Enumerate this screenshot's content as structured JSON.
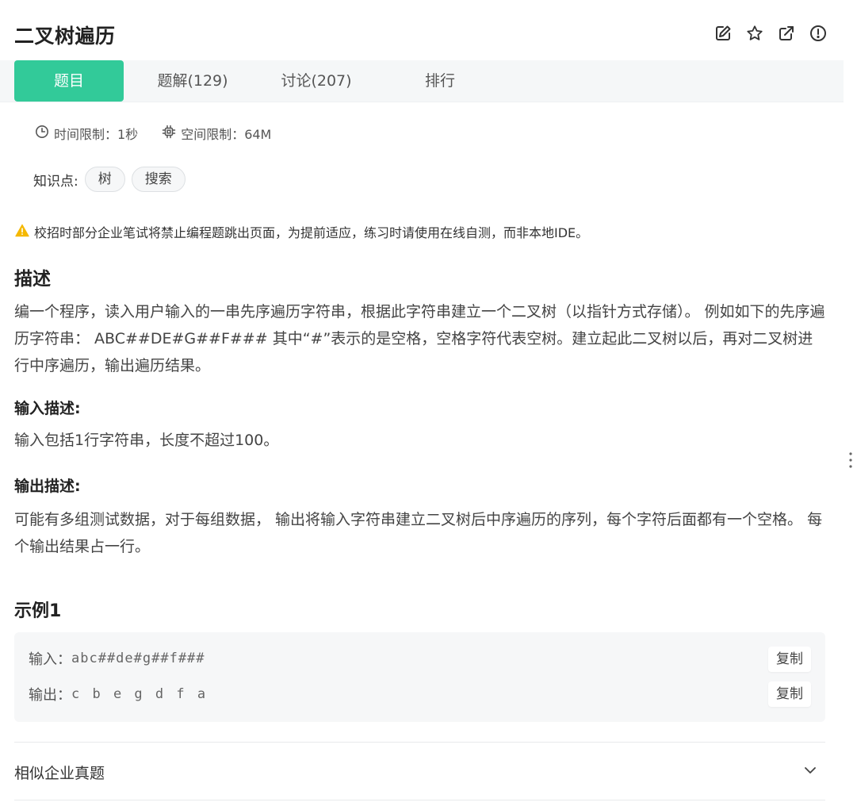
{
  "title": "二叉树遍历",
  "header_icons": [
    "edit-icon",
    "star-icon",
    "open-external-icon",
    "report-icon"
  ],
  "tabs": [
    {
      "label": "题目",
      "active": true
    },
    {
      "label": "题解(129)",
      "active": false
    },
    {
      "label": "讨论(207)",
      "active": false
    },
    {
      "label": "排行",
      "active": false
    }
  ],
  "limits": {
    "time": "时间限制：1秒",
    "space": "空间限制：64M"
  },
  "knowledge": {
    "label": "知识点:",
    "tags": [
      "树",
      "搜索"
    ]
  },
  "warning": "校招时部分企业笔试将禁止编程题跳出页面，为提前适应，练习时请使用在线自测，而非本地IDE。",
  "description": {
    "heading": "描述",
    "text": "编一个程序，读入用户输入的一串先序遍历字符串，根据此字符串建立一个二叉树（以指针方式存储）。 例如如下的先序遍历字符串： ABC##DE#G##F### 其中“#”表示的是空格，空格字符代表空树。建立起此二叉树以后，再对二叉树进行中序遍历，输出遍历结果。"
  },
  "input_desc": {
    "heading": "输入描述:",
    "text": "输入包括1行字符串，长度不超过100。"
  },
  "output_desc": {
    "heading": "输出描述:",
    "text": "可能有多组测试数据，对于每组数据， 输出将输入字符串建立二叉树后中序遍历的序列，每个字符后面都有一个空格。 每个输出结果占一行。"
  },
  "sample": {
    "heading": "示例1",
    "input_label": "输入：",
    "input_value": "abc##de#g##f###",
    "output_label": "输出：",
    "output_value": "c b e g d f a",
    "copy_label": "复制"
  },
  "similar": {
    "label": "相似企业真题"
  },
  "colors": {
    "accent": "#32ca99",
    "warning": "#f5b800",
    "tab_bar_bg": "#f5f7f8"
  }
}
